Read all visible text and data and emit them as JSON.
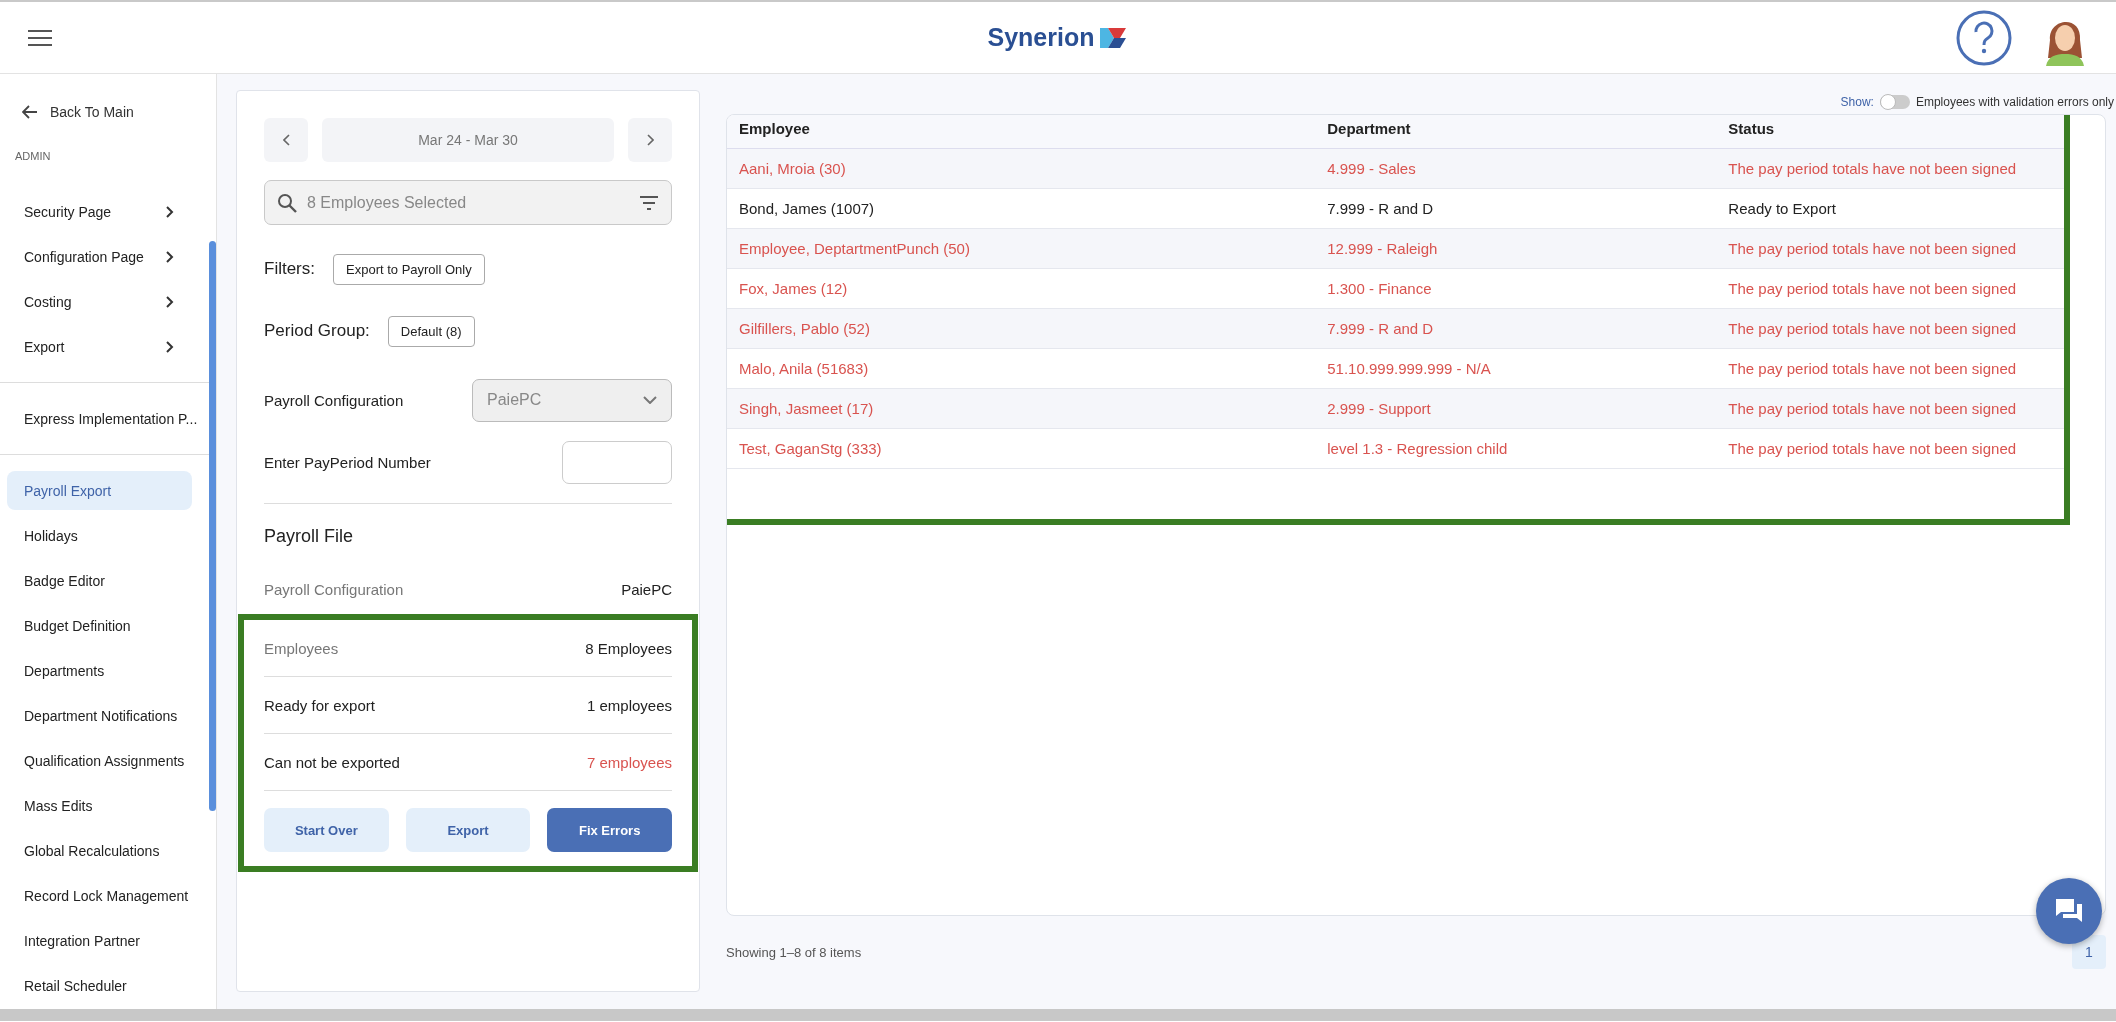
{
  "header": {
    "logo": "Synerion"
  },
  "sidebar": {
    "back": "Back To Main",
    "section": "ADMIN",
    "groups": [
      [
        {
          "label": "Security Page",
          "kind": "submenu",
          "selected": false
        },
        {
          "label": "Configuration Page",
          "kind": "submenu",
          "selected": false
        },
        {
          "label": "Costing",
          "kind": "submenu",
          "selected": false
        },
        {
          "label": "Export",
          "kind": "submenu",
          "selected": false
        }
      ],
      [
        {
          "label": "Express Implementation P...",
          "kind": "link",
          "selected": false
        }
      ],
      [
        {
          "label": "Payroll Export",
          "kind": "link",
          "selected": true
        },
        {
          "label": "Holidays",
          "kind": "link",
          "selected": false
        },
        {
          "label": "Badge Editor",
          "kind": "link",
          "selected": false
        },
        {
          "label": "Budget Definition",
          "kind": "link",
          "selected": false
        },
        {
          "label": "Departments",
          "kind": "link",
          "selected": false
        },
        {
          "label": "Department Notifications",
          "kind": "link",
          "selected": false
        },
        {
          "label": "Qualification Assignments",
          "kind": "link",
          "selected": false
        },
        {
          "label": "Mass Edits",
          "kind": "link",
          "selected": false
        },
        {
          "label": "Global Recalculations",
          "kind": "link",
          "selected": false
        },
        {
          "label": "Record Lock Management",
          "kind": "link",
          "selected": false
        },
        {
          "label": "Integration Partner",
          "kind": "link",
          "selected": false
        },
        {
          "label": "Retail Scheduler",
          "kind": "link",
          "selected": false
        }
      ]
    ]
  },
  "panel": {
    "date_range": "Mar 24 - Mar 30",
    "search": {
      "placeholder": "8 Employees Selected"
    },
    "filters_label": "Filters:",
    "filter_button": "Export to Payroll Only",
    "period_group_label": "Period Group:",
    "period_group_button": "Default (8)",
    "payroll_config_label": "Payroll Configuration",
    "payroll_config_value": "PaiePC",
    "pay_period_label": "Enter PayPeriod Number",
    "file_title": "Payroll File",
    "file_config_label": "Payroll Configuration",
    "file_config_value": "PaiePC",
    "summary": {
      "highlighted": true,
      "rows": [
        {
          "label": "Employees",
          "value": "8 Employees",
          "error": false,
          "muted_label": true
        },
        {
          "label": "Ready for export",
          "value": "1 employees",
          "error": false,
          "muted_label": false
        },
        {
          "label": "Can not be exported",
          "value": "7 employees",
          "error": true,
          "muted_label": false
        }
      ],
      "buttons": [
        {
          "label": "Start Over",
          "kind": "secondary"
        },
        {
          "label": "Export",
          "kind": "secondary"
        },
        {
          "label": "Fix Errors",
          "kind": "primary"
        }
      ]
    }
  },
  "table": {
    "show_label": "Show:",
    "toggle": {
      "label": "Employees with validation errors only",
      "on": false
    },
    "highlighted": true,
    "columns": [
      "Employee",
      "Department",
      "Status"
    ],
    "rows": [
      {
        "cells": [
          "Aani, Mroia (30)",
          "4.999 - Sales",
          "The pay period totals have not been signed"
        ],
        "error": true
      },
      {
        "cells": [
          "Bond, James (1007)",
          "7.999 - R and D",
          "Ready to Export"
        ],
        "error": false
      },
      {
        "cells": [
          "Employee, DeptartmentPunch (50)",
          "12.999 - Raleigh",
          "The pay period totals have not been signed"
        ],
        "error": true
      },
      {
        "cells": [
          "Fox, James (12)",
          "1.300 - Finance",
          "The pay period totals have not been signed"
        ],
        "error": true
      },
      {
        "cells": [
          "Gilfillers, Pablo (52)",
          "7.999 - R and D",
          "The pay period totals have not been signed"
        ],
        "error": true
      },
      {
        "cells": [
          "Malo, Anila (51683)",
          "51.10.999.999.999 - N/A",
          "The pay period totals have not been signed"
        ],
        "error": true
      },
      {
        "cells": [
          "Singh, Jasmeet (17)",
          "2.999 - Support",
          "The pay period totals have not been signed"
        ],
        "error": true
      },
      {
        "cells": [
          "Test, GaganStg (333)",
          "level 1.3 - Regression child",
          "The pay period totals have not been signed"
        ],
        "error": true
      }
    ],
    "footer": "Showing 1–8 of 8 items",
    "page": "1"
  }
}
